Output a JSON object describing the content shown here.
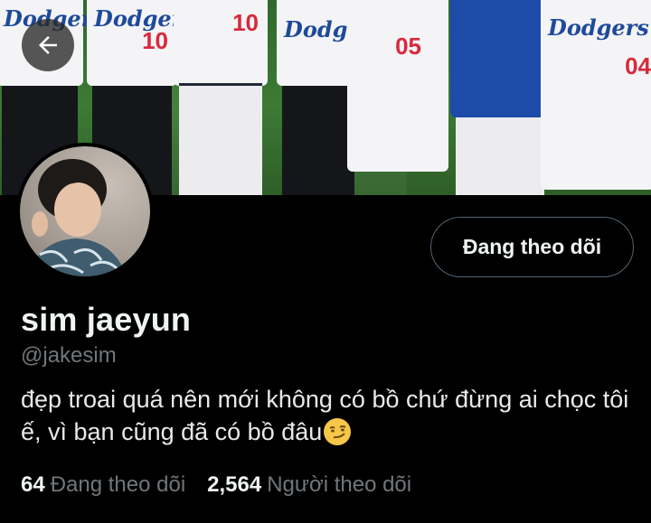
{
  "banner": {
    "jersey_script": "Dodgers",
    "numbers": [
      "10",
      "10",
      "05",
      "04"
    ]
  },
  "profile": {
    "display_name": "sim jaeyun",
    "handle": "@jakesim",
    "bio_text": "đẹp troai quá nên mới không có bồ chứ đừng ai chọc tôi ế, vì bạn cũng đã có bồ đâu",
    "bio_emoji": "smirking-face",
    "follow_button_label": "Đang theo dõi"
  },
  "stats": {
    "following_count": "64",
    "following_label": "Đang theo dõi",
    "followers_count": "2,564",
    "followers_label": "Người theo dõi"
  },
  "colors": {
    "background": "#000000",
    "primary_text": "#eff3f4",
    "secondary_text": "#71767b",
    "button_border": "#536471"
  },
  "icons": {
    "back": "arrow-left-icon",
    "emoji": "smirking-face-emoji"
  }
}
